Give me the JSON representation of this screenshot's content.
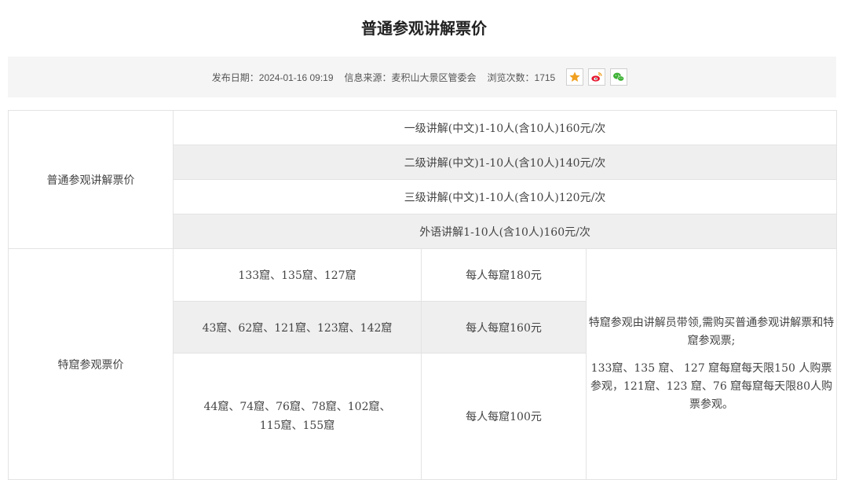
{
  "page": {
    "title": "普通参观讲解票价"
  },
  "meta": {
    "publish_date": "发布日期：2024-01-16 09:19",
    "source": "信息来源：麦积山大景区管委会",
    "views": "浏览次数：1715",
    "share_icons": [
      "favorite-star-icon",
      "weibo-icon",
      "wechat-icon"
    ],
    "share_colors": {
      "border": "#d0d0d0",
      "star": "#f0a020",
      "weibo": "#e6162d",
      "wechat": "#3eb135"
    }
  },
  "table": {
    "general": {
      "label": "普通参观讲解票价",
      "rows": [
        "一级讲解(中文)1-10人(含10人)160元/次",
        "二级讲解(中文)1-10人(含10人)140元/次",
        "三级讲解(中文)1-10人(含10人)120元/次",
        "外语讲解1-10人(含10人)160元/次"
      ]
    },
    "special": {
      "label": "特窟参观票价",
      "rows": [
        {
          "caves": "133窟、135窟、127窟",
          "price": "每人每窟180元"
        },
        {
          "caves": "43窟、62窟、121窟、123窟、142窟",
          "price": "每人每窟160元"
        },
        {
          "caves": "44窟、74窟、76窟、78窟、102窟、115窟、155窟",
          "price": "每人每窟100元"
        }
      ],
      "notes": [
        "特窟参观由讲解员带领,需购买普通参观讲解票和特窟参观票;",
        "133窟、135 窟、 127 窟每窟每天限150 人购票参观，121窟、123 窟、76 窟每窟每天限80人购票参观。"
      ]
    }
  }
}
